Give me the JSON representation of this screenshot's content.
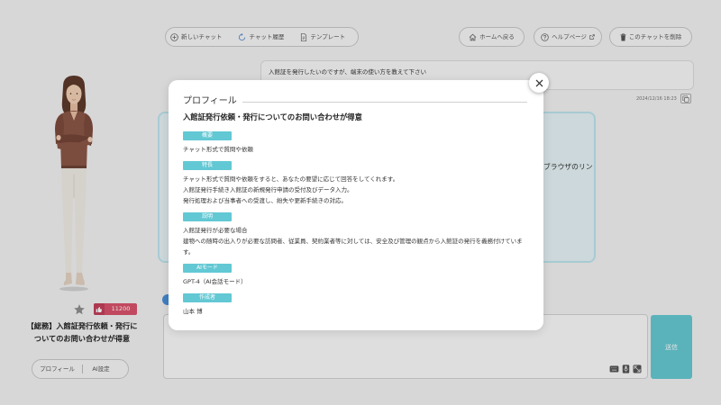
{
  "toolbar": {
    "new_chat": "新しいチャット",
    "history": "チャット履歴",
    "template": "テンプレート",
    "home": "ホームへ戻る",
    "help": "ヘルプページ",
    "delete_chat": "このチャットを削除"
  },
  "character": {
    "likes": "11200",
    "title": "【総務】入館証発行依頼・発行についてのお問い合わせが得意",
    "tabs": [
      {
        "label": "プロフィール"
      },
      {
        "label": "AI設定"
      }
    ]
  },
  "chat": {
    "user_message": {
      "text": "入館証を発行したいのですが、端末の使い方を教えて下さい",
      "timestamp": "2024/12/16 18:23"
    },
    "ai_message": {
      "visible_text": "ブラウザのリン"
    },
    "send_label": "送信"
  },
  "modal": {
    "title": "プロフィール",
    "subtitle": "入館証発行依頼・発行についてのお問い合わせが得意",
    "sections": [
      {
        "label": "概要",
        "lines": [
          "チャット形式で質問や依頼"
        ]
      },
      {
        "label": "特長",
        "lines": [
          "チャット形式で質問や依頼をすると、あなたの要望に応じて回答をしてくれます。",
          "入館証発行手続き入館証の新規発行申請の受付及びデータ入力。",
          "発行処理および当事者への受渡し、紛失や更新手続きの対応。"
        ]
      },
      {
        "label": "説明",
        "lines": [
          "入館証発行が必要な場合",
          "建物への随時の出入りが必要な訪問者、従業員、契約業者等に対しては、安全及び管理の観点から入館証の発行を義務付けています。"
        ]
      },
      {
        "label": "AIモード",
        "lines": [
          "GPT-4（AI会話モード）"
        ]
      },
      {
        "label": "作成者",
        "lines": [
          "山本 博"
        ]
      }
    ]
  },
  "icons": {
    "new_chat": "plus-circle-icon",
    "history": "history-icon",
    "template": "document-icon",
    "home": "home-icon",
    "help": "help-circle-icon",
    "help_external": "external-link-icon",
    "delete_chat": "trash-icon",
    "copy": "copy-icon",
    "favorite": "star-icon",
    "likes": "thumbs-up-icon",
    "keyboard": "keyboard-icon",
    "microphone": "microphone-icon",
    "expand": "expand-icon",
    "close": "close-icon"
  },
  "colors": {
    "accent": "#62c8d4",
    "like": "#d9536b",
    "like_dark": "#c2405a",
    "send": "#66c9d2",
    "ai_bubble": "#e6f3f7",
    "ai_border": "#bde4ee",
    "ai_avatar": "#4a8fd8"
  }
}
